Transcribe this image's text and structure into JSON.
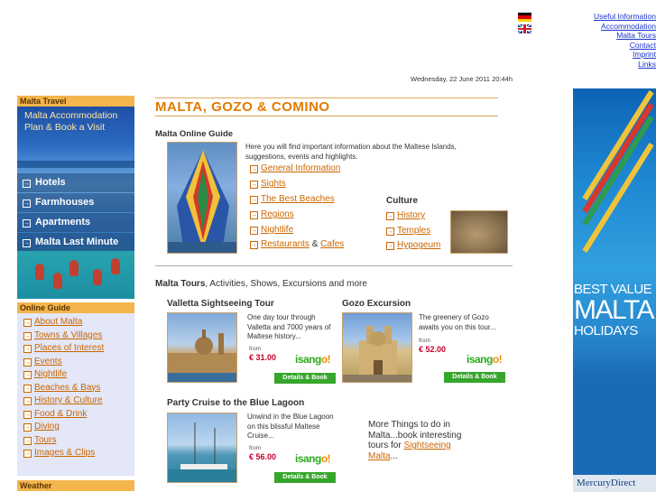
{
  "flags": {
    "german": "german-flag-icon",
    "english": "english-flag-icon"
  },
  "top_links": [
    "Useful Information",
    "Accommodation",
    "Malta Tours",
    "Contact",
    "Imprint",
    "Links"
  ],
  "datetime": "Wednesday, 22 June 2011 20:44h",
  "sidebar": {
    "travel_heading": "Malta Travel",
    "intro_line1": "Malta Accommodation",
    "intro_line2": "Plan & Book a Visit",
    "items": [
      {
        "label": "Hotels"
      },
      {
        "label": "Farmhouses"
      },
      {
        "label": "Apartments"
      },
      {
        "label": "Malta Last Minute"
      }
    ],
    "guide_heading": "Online Guide",
    "guide_items": [
      "About Malta",
      "Towns & Villages",
      "Places of Interest",
      "Events",
      "Nightlife",
      "Beaches & Bays",
      "History & Culture",
      "Food & Drink",
      "Diving",
      "Tours",
      "Images & Clips"
    ],
    "weather_heading": "Weather"
  },
  "main": {
    "title": "MALTA, GOZO & COMINO",
    "guide_title": "Malta Online Guide",
    "guide_intro": "Here you will find important information about the Maltese Islands, suggestions, events and highlights.",
    "guide_links": [
      "General Information",
      "Sights",
      "The Best Beaches",
      "Regions",
      "Nightlife"
    ],
    "restaurants": "Restaurants",
    "amp": "&",
    "cafes": "Cafes",
    "culture_title": "Culture",
    "culture_links": [
      "History",
      "Temples",
      "Hypogeum"
    ],
    "tours_title_bold": "Malta Tours",
    "tours_title_rest": ", Activities, Shows, Excursions and more",
    "tours": [
      {
        "title": "Valletta Sightseeing Tour",
        "desc": "One day tour through Valletta and 7000 years of Maltese history...",
        "from": "from",
        "price": "€ 31.00",
        "button": "Details & Book"
      },
      {
        "title": "Gozo Excursion",
        "desc": "The greenery of Gozo awaits you on this tour...",
        "from": "from",
        "price": "€ 52.00",
        "button": "Details & Book"
      },
      {
        "title": "Party Cruise to the Blue Lagoon",
        "desc": "Unwind in the Blue Lagoon on this blissful Maltese Cruise...",
        "from": "from",
        "price": "€ 56.00",
        "button": "Details & Book"
      }
    ],
    "isango_a": "isang",
    "isango_b": "o!",
    "more_text": "More Things to do in Malta...book interesting tours for",
    "more_link": "Sightseeing Malta",
    "more_tail": "..."
  },
  "ad": {
    "line1": "BEST VALUE",
    "line2": "MALTA",
    "line3": "HOLIDAYS",
    "brand": "MercuryDirect"
  },
  "colors": {
    "accent": "#e07b00",
    "link": "#cc6600",
    "sidebar_heading": "#f3b54c",
    "guide_bg": "#e3e7f7",
    "button": "#36a62c",
    "price": "#c4002b"
  }
}
